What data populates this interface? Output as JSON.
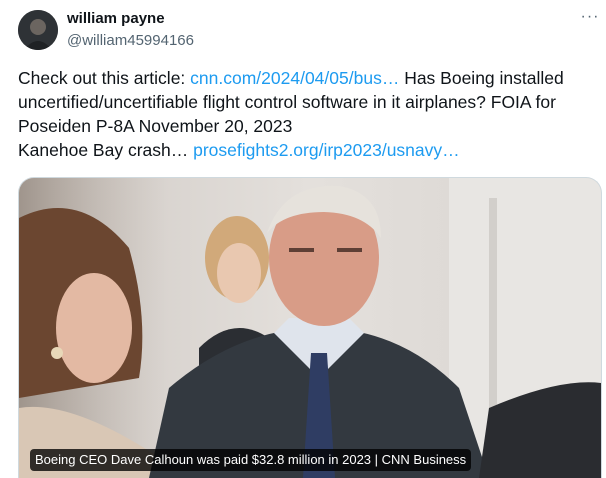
{
  "author": {
    "name": "william payne",
    "handle": "@william45994166"
  },
  "more_menu": {
    "icon": "more-dots-icon",
    "label": "···"
  },
  "tweet": {
    "line1_text": "Check out this article: ",
    "line1_link": "cnn.com/2024/04/05/bus…",
    "line1_tail": " Has Boeing installed",
    "line2": "uncertified/uncertifiable flight control software in it airplanes? FOIA for",
    "line3": "Poseiden P-8A November 20, 2023",
    "line4_text": "Kanehoe Bay crash… ",
    "line4_link": "prosefights2.org/irp2023/usnavy…"
  },
  "card": {
    "caption": "Boeing CEO Dave Calhoun was paid $32.8 million in 2023 | CNN Business"
  },
  "colors": {
    "link": "#1d9bf0",
    "text": "#0f1419",
    "secondary": "#536471"
  }
}
